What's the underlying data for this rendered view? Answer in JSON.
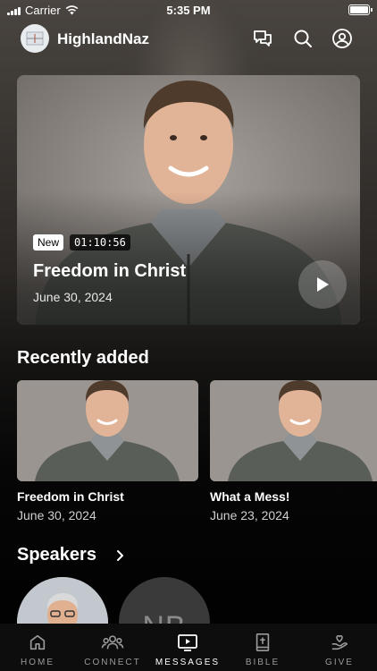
{
  "status_bar": {
    "carrier": "Carrier",
    "time": "5:35 PM"
  },
  "header": {
    "app_name": "HighlandNaz",
    "icons": [
      "chat-icon",
      "search-icon",
      "profile-icon"
    ]
  },
  "hero": {
    "badge_new": "New",
    "duration": "01:10:56",
    "title": "Freedom in Christ",
    "date": "June 30, 2024"
  },
  "recently_added": {
    "title": "Recently added",
    "items": [
      {
        "title": "Freedom in Christ",
        "date": "June 30, 2024"
      },
      {
        "title": "What a Mess!",
        "date": "June 23, 2024"
      }
    ]
  },
  "speakers": {
    "title": "Speakers",
    "items": [
      {
        "initials": ""
      },
      {
        "initials": "NB"
      }
    ]
  },
  "tab_bar": {
    "items": [
      {
        "label": "HOME",
        "icon": "home-icon"
      },
      {
        "label": "CONNECT",
        "icon": "people-icon"
      },
      {
        "label": "MESSAGES",
        "icon": "tv-play-icon"
      },
      {
        "label": "BIBLE",
        "icon": "bible-icon"
      },
      {
        "label": "GIVE",
        "icon": "give-icon"
      }
    ],
    "active": "MESSAGES"
  },
  "colors": {
    "accent": "#ffffff",
    "inactive": "#9a9a9a",
    "tab_bg": "#0d0d0d"
  }
}
